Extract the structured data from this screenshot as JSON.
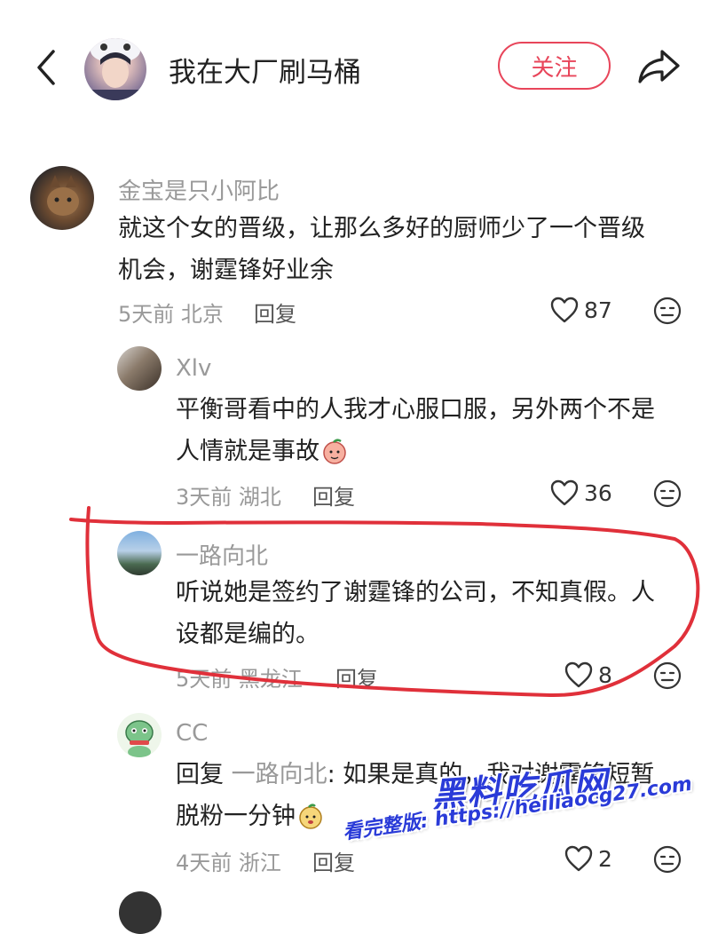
{
  "header": {
    "back_icon": "chevron-left-icon",
    "title": "我在大厂刷马桶",
    "follow_label": "关注",
    "share_icon": "share-arrow-icon"
  },
  "comments": [
    {
      "user": "金宝是只小阿比",
      "text_lines": [
        "就这个女的晋级，让那么多好的厨师少了一个晋级",
        "机会，谢霆锋好业余"
      ],
      "time": "5天前",
      "location": "北京",
      "reply_label": "回复",
      "likes": "87"
    },
    {
      "user": "Xlv",
      "text_lines": [
        "平衡哥看中的人我才心服口服，另外两个不是",
        "人情就是事故"
      ],
      "time": "3天前",
      "location": "湖北",
      "reply_label": "回复",
      "likes": "36"
    },
    {
      "user": "一路向北",
      "text_lines": [
        "听说她是签约了谢霆锋的公司，不知真假。人",
        "设都是编的。"
      ],
      "time": "5天前",
      "location": "黑龙江",
      "reply_label": "回复",
      "likes": "8"
    },
    {
      "user": "CC",
      "reply_prefix": "回复",
      "reply_target": "一路向北",
      "text_lines": [
        ": 如果是真的，我对谢霆锋短暂",
        "脱粉一分钟"
      ],
      "time": "4天前",
      "location": "浙江",
      "reply_label": "回复",
      "likes": "2"
    }
  ],
  "watermark": {
    "logo": "黑料吃瓜网",
    "url": "看完整版: https://heiliaocg27.com"
  },
  "colors": {
    "accent": "#e8455a",
    "annotation": "#e0303a",
    "watermark": "#2a3bd8"
  }
}
